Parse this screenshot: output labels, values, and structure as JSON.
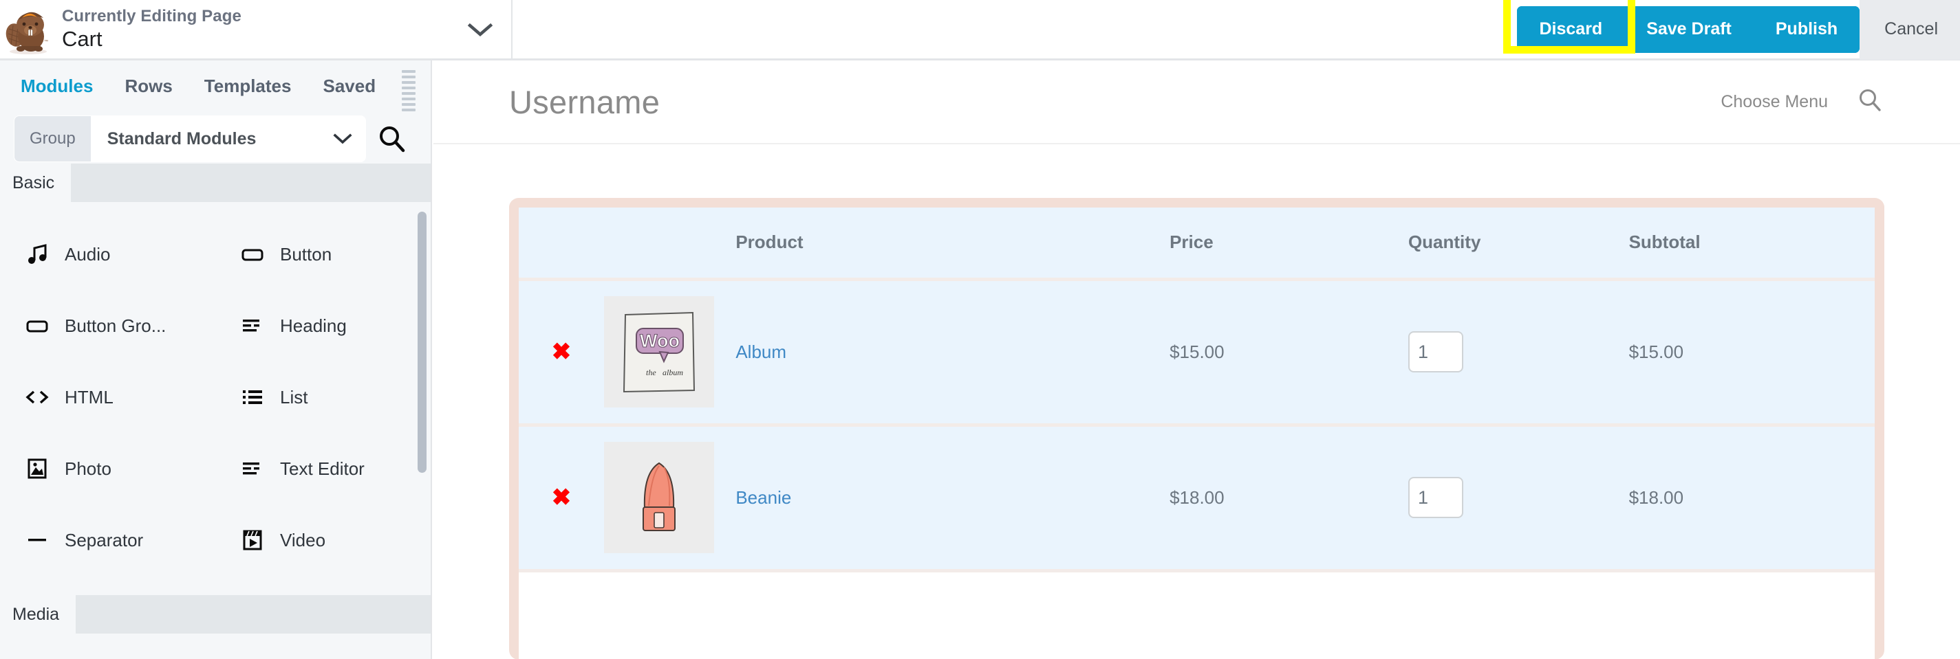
{
  "topbar": {
    "editing_label": "Currently Editing Page",
    "page_name": "Cart",
    "switcher_chevron_icon": "chevron-down-icon",
    "logo_icon": "beaver-builder-logo",
    "buttons": {
      "discard": "Discard",
      "save_draft": "Save Draft",
      "publish": "Publish",
      "cancel": "Cancel"
    },
    "colors": {
      "primary": "#0d9ccd",
      "highlight": "#ffff00",
      "cancel_bg": "#e9ebee"
    }
  },
  "sidebar": {
    "tabs": [
      {
        "label": "Modules",
        "active": true
      },
      {
        "label": "Rows",
        "active": false
      },
      {
        "label": "Templates",
        "active": false
      },
      {
        "label": "Saved",
        "active": false
      }
    ],
    "group": {
      "label": "Group",
      "value": "Standard Modules",
      "chevron_icon": "chevron-down-icon",
      "search_icon": "search-icon"
    },
    "sections": [
      {
        "title": "Basic"
      },
      {
        "title": "Media"
      }
    ],
    "modules": [
      {
        "label": "Audio",
        "icon": "music-note-icon"
      },
      {
        "label": "Button",
        "icon": "button-rect-icon"
      },
      {
        "label": "Button Gro...",
        "icon": "button-rect-icon"
      },
      {
        "label": "Heading",
        "icon": "heading-lines-icon"
      },
      {
        "label": "HTML",
        "icon": "code-brackets-icon"
      },
      {
        "label": "List",
        "icon": "list-bullets-icon"
      },
      {
        "label": "Photo",
        "icon": "photo-icon"
      },
      {
        "label": "Text Editor",
        "icon": "text-lines-icon"
      },
      {
        "label": "Separator",
        "icon": "separator-dash-icon"
      },
      {
        "label": "Video",
        "icon": "video-clapper-icon"
      }
    ]
  },
  "canvas": {
    "site_title": "Username",
    "nav": {
      "choose_menu": "Choose Menu",
      "search_icon": "search-icon"
    },
    "cart": {
      "headers": [
        "",
        "",
        "Product",
        "Price",
        "Quantity",
        "Subtotal"
      ],
      "rows": [
        {
          "remove": "✖",
          "thumb_alt": "album-thumbnail",
          "thumb_caption": "Woo",
          "thumb_subcaption": "the album",
          "product": "Album",
          "price": "$15.00",
          "quantity": "1",
          "subtotal": "$15.00"
        },
        {
          "remove": "✖",
          "thumb_alt": "beanie-thumbnail",
          "thumb_caption": "",
          "thumb_subcaption": "",
          "product": "Beanie",
          "price": "$18.00",
          "quantity": "1",
          "subtotal": "$18.00"
        }
      ]
    }
  }
}
